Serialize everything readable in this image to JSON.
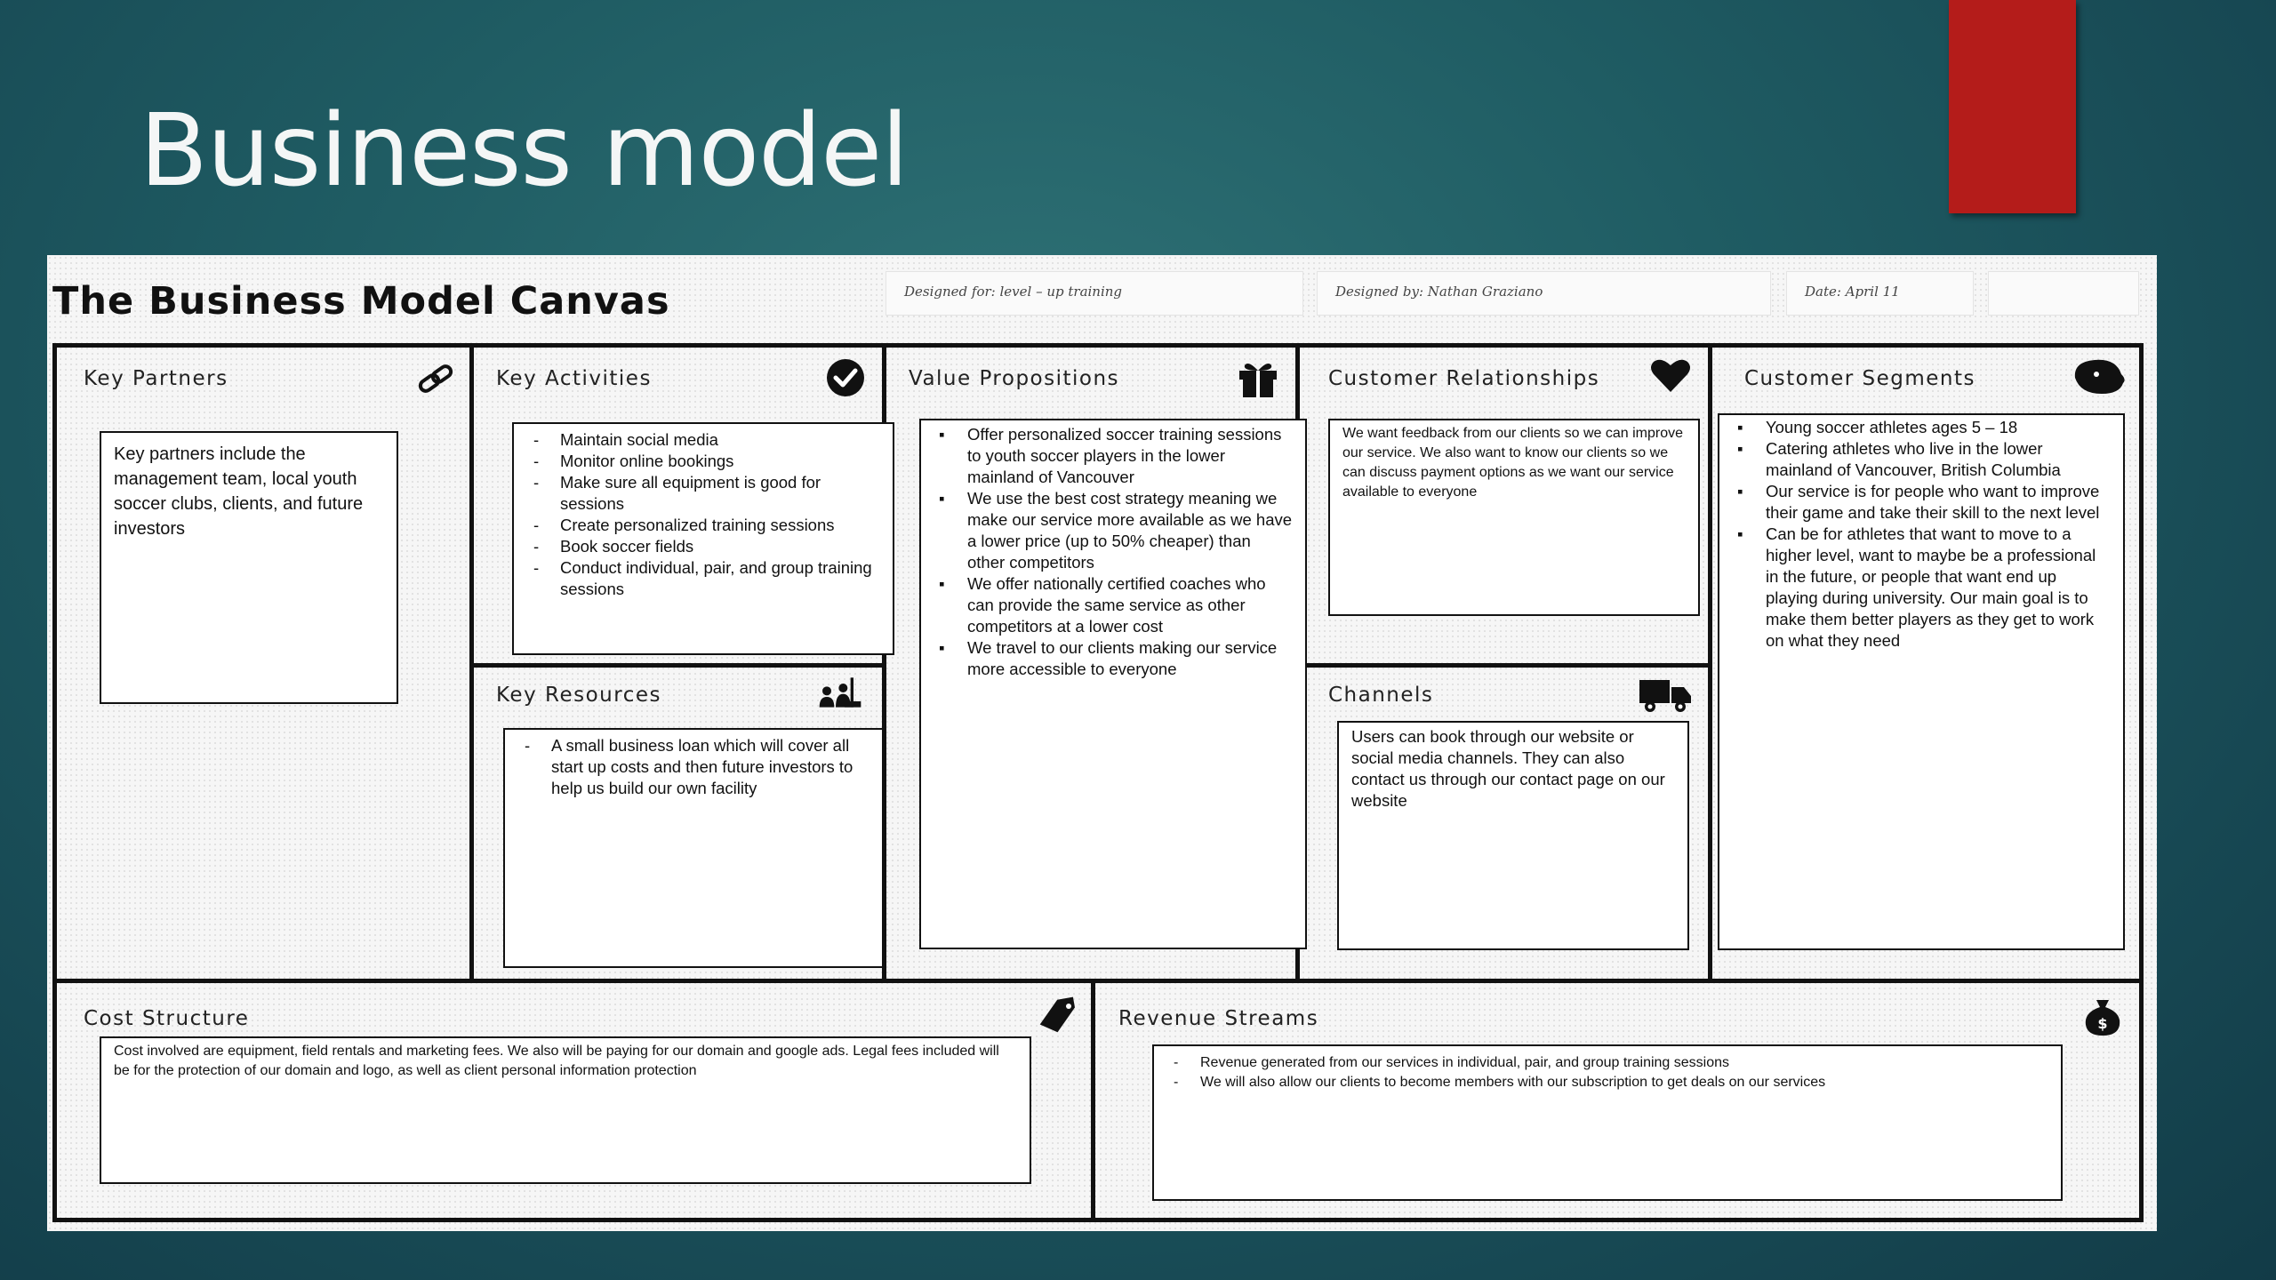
{
  "slide": {
    "title": "Business model"
  },
  "canvas": {
    "title": "The Business Model Canvas",
    "designed_for": "Designed  for:  level  –  up  training",
    "designed_by": "Designed  by:  Nathan  Graziano",
    "date": "Date:  April  11",
    "version": ""
  },
  "key_partners": {
    "heading": "Key Partners",
    "icon": "link-icon",
    "text": "Key partners include the management team, local youth soccer clubs, clients, and future investors"
  },
  "key_activities": {
    "heading": "Key Activities",
    "icon": "checkmark-icon",
    "items": [
      "Maintain social media",
      "Monitor online bookings",
      "Make sure all equipment is good for sessions",
      "Create personalized training sessions",
      "Book soccer fields",
      "Conduct individual, pair, and group training sessions"
    ]
  },
  "key_resources": {
    "heading": "Key Resources",
    "icon": "workers-icon",
    "items": [
      "A small business loan which will cover all start up costs and then future investors to help us build our own facility"
    ]
  },
  "value_propositions": {
    "heading": "Value Propositions",
    "icon": "gift-icon",
    "items": [
      "Offer personalized soccer training sessions to youth soccer players in the lower mainland of Vancouver",
      "We use the best cost strategy meaning we make our service more available as we have a lower price (up to 50% cheaper) than other competitors",
      "We offer nationally certified coaches who can provide the same service as other competitors at a lower cost",
      "We travel to our clients making our service more accessible to everyone"
    ]
  },
  "customer_relationships": {
    "heading": "Customer Relationships",
    "icon": "heart-icon",
    "text": "We want feedback from our clients so we can improve our service. We also want to know our clients so we can discuss payment options as we want our service available to everyone"
  },
  "channels": {
    "heading": "Channels",
    "icon": "truck-icon",
    "text": "Users can book through our website or social media channels. They can also contact us through our contact page on our website"
  },
  "customer_segments": {
    "heading": "Customer Segments",
    "icon": "head-icon",
    "items": [
      "Young soccer athletes ages 5 – 18",
      "Catering athletes who live in the lower mainland of Vancouver, British Columbia",
      "Our service is for people who want to improve their game and take their skill to the next level",
      "Can be for athletes that want to move to a higher level, want to maybe be a professional in the future, or people that want end up playing during university. Our main goal is to make them better players as they get to work on what they need"
    ]
  },
  "cost_structure": {
    "heading": "Cost Structure",
    "icon": "price-tag-icon",
    "text": "Cost involved are equipment, field rentals and marketing fees. We also will be paying for our domain and google ads. Legal fees included will be for the protection of our domain and logo, as well as client personal information protection"
  },
  "revenue_streams": {
    "heading": "Revenue Streams",
    "icon": "money-bag-icon",
    "items": [
      "Revenue generated from our services in individual, pair, and group training sessions",
      "We will also allow our clients to become members with our subscription to get deals on our services"
    ]
  }
}
